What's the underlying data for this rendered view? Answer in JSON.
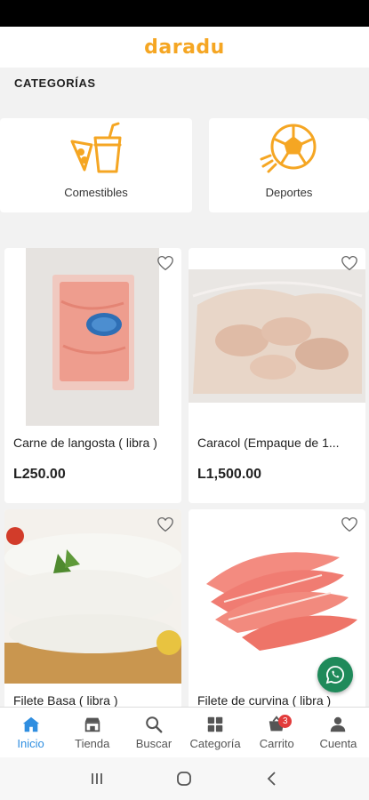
{
  "header": {
    "logo_text": "daradu"
  },
  "categories": {
    "title": "CATEGORÍAS",
    "items": [
      {
        "label": "Comestibles",
        "icon": "food-drink-icon"
      },
      {
        "label": "Deportes",
        "icon": "soccer-ball-icon"
      }
    ]
  },
  "products": [
    {
      "name": "Carne de langosta ( libra )",
      "price": "L250.00"
    },
    {
      "name": "Caracol (Empaque de 1...",
      "price": "L1,500.00"
    },
    {
      "name": "Filete Basa ( libra )",
      "price": ""
    },
    {
      "name": "Filete de curvina ( libra )",
      "price": ""
    }
  ],
  "bottom_nav": {
    "items": [
      {
        "label": "Inicio",
        "icon": "home-icon"
      },
      {
        "label": "Tienda",
        "icon": "store-icon"
      },
      {
        "label": "Buscar",
        "icon": "search-icon"
      },
      {
        "label": "Categoría",
        "icon": "grid-icon"
      },
      {
        "label": "Carrito",
        "icon": "cart-icon",
        "badge": "3"
      },
      {
        "label": "Cuenta",
        "icon": "user-icon"
      }
    ]
  },
  "colors": {
    "brand": "#f5a623",
    "active": "#2f8ee0",
    "whatsapp": "#1f8a5a",
    "badge": "#e23b3b"
  }
}
